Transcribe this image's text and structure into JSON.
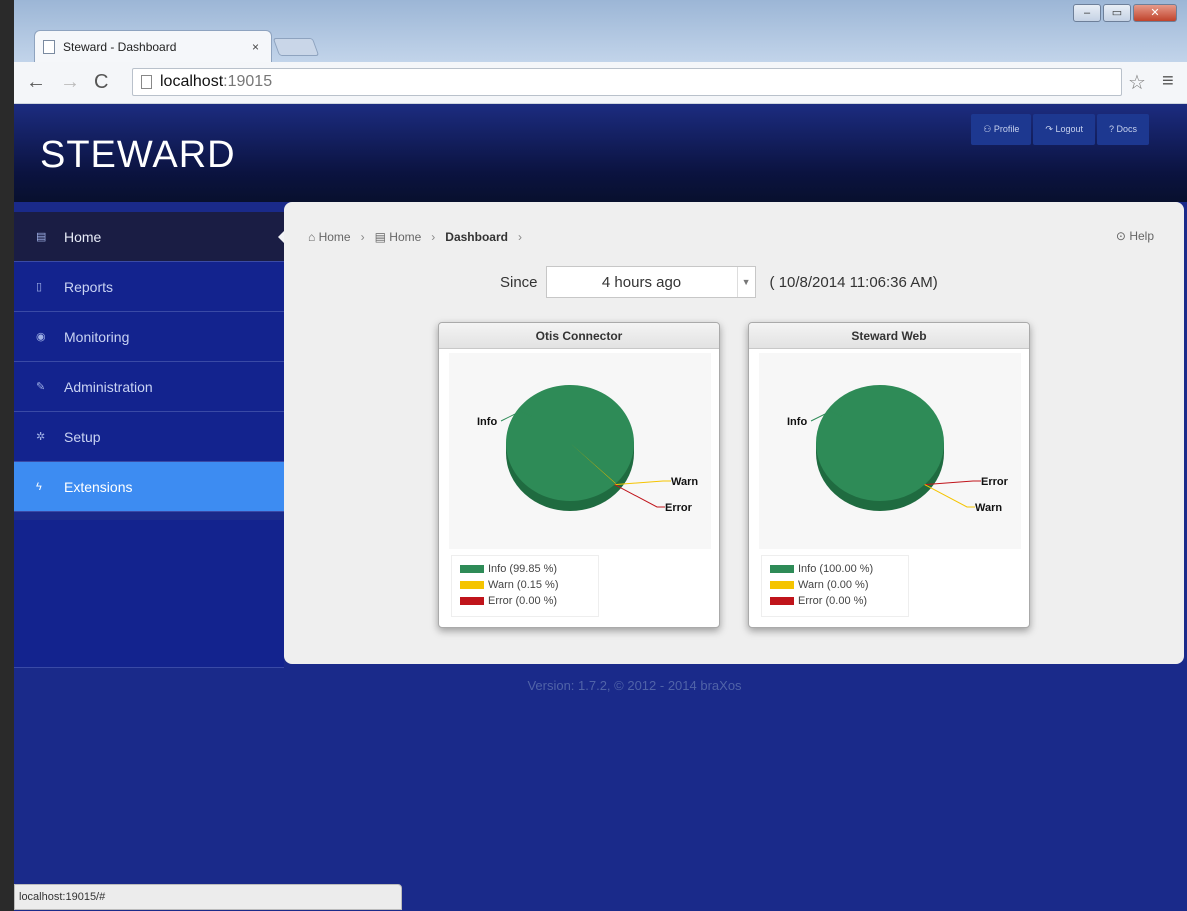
{
  "browser": {
    "tab_title": "Steward - Dashboard",
    "tab_close": "×",
    "url_host": "localhost",
    "url_port": ":19015",
    "status_url": "localhost:19015/#",
    "window_controls": [
      "–",
      "▭",
      "✕"
    ]
  },
  "header": {
    "logo": "STEWARD",
    "buttons": [
      "Profile",
      "Logout",
      "Docs"
    ]
  },
  "sidebar": {
    "items": [
      {
        "label": "Home",
        "icon": "chart-icon"
      },
      {
        "label": "Reports",
        "icon": "document-icon"
      },
      {
        "label": "Monitoring",
        "icon": "eye-icon"
      },
      {
        "label": "Administration",
        "icon": "wrench-icon"
      },
      {
        "label": "Setup",
        "icon": "gear-icon"
      },
      {
        "label": "Extensions",
        "icon": "bolt-icon"
      }
    ],
    "active": "Extensions"
  },
  "breadcrumb": {
    "items": [
      "Home",
      "Home",
      "Dashboard"
    ],
    "help": "Help"
  },
  "since": {
    "label": "Since",
    "selected": "4 hours ago",
    "timestamp": "( 10/8/2014 11:06:36 AM)"
  },
  "colors": {
    "info": "#2e8b57",
    "warn": "#f5c400",
    "error": "#c0141b",
    "sidebar_active": "#3d8cf2"
  },
  "chart_data": [
    {
      "type": "pie",
      "title": "Otis Connector",
      "categories": [
        "Info",
        "Warn",
        "Error"
      ],
      "values": [
        99.85,
        0.15,
        0.0
      ],
      "legend": [
        "Info (99.85 %)",
        "Warn (0.15 %)",
        "Error (0.00 %)"
      ]
    },
    {
      "type": "pie",
      "title": "Steward Web",
      "categories": [
        "Info",
        "Warn",
        "Error"
      ],
      "values": [
        100.0,
        0.0,
        0.0
      ],
      "legend": [
        "Info (100.00 %)",
        "Warn (0.00 %)",
        "Error (0.00 %)"
      ]
    }
  ],
  "footer": "Version: 1.7.2, © 2012 - 2014 braXos"
}
